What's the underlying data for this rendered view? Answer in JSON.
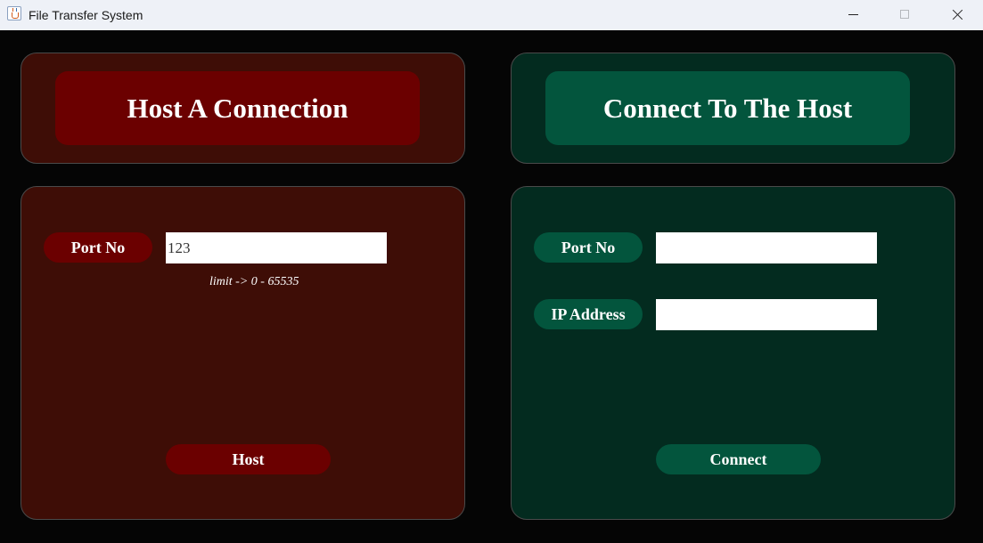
{
  "window": {
    "title": "File Transfer System",
    "controls": {
      "minimize_icon": "minimize-icon",
      "maximize_icon": "maximize-icon",
      "close_icon": "close-icon"
    }
  },
  "host_panel": {
    "title": "Host A Connection",
    "port_label": "Port No",
    "port_value": "123",
    "port_hint": "limit -> 0 - 65535",
    "host_button": "Host"
  },
  "connect_panel": {
    "title": "Connect To The Host",
    "port_label": "Port No",
    "port_value": "",
    "ip_label": "IP Address",
    "ip_value": "",
    "connect_button": "Connect"
  },
  "colors": {
    "background": "#050505",
    "host_panel_bg": "#3e0d06",
    "host_accent": "#6b0000",
    "connect_panel_bg": "#032b1f",
    "connect_accent": "#03553d"
  }
}
